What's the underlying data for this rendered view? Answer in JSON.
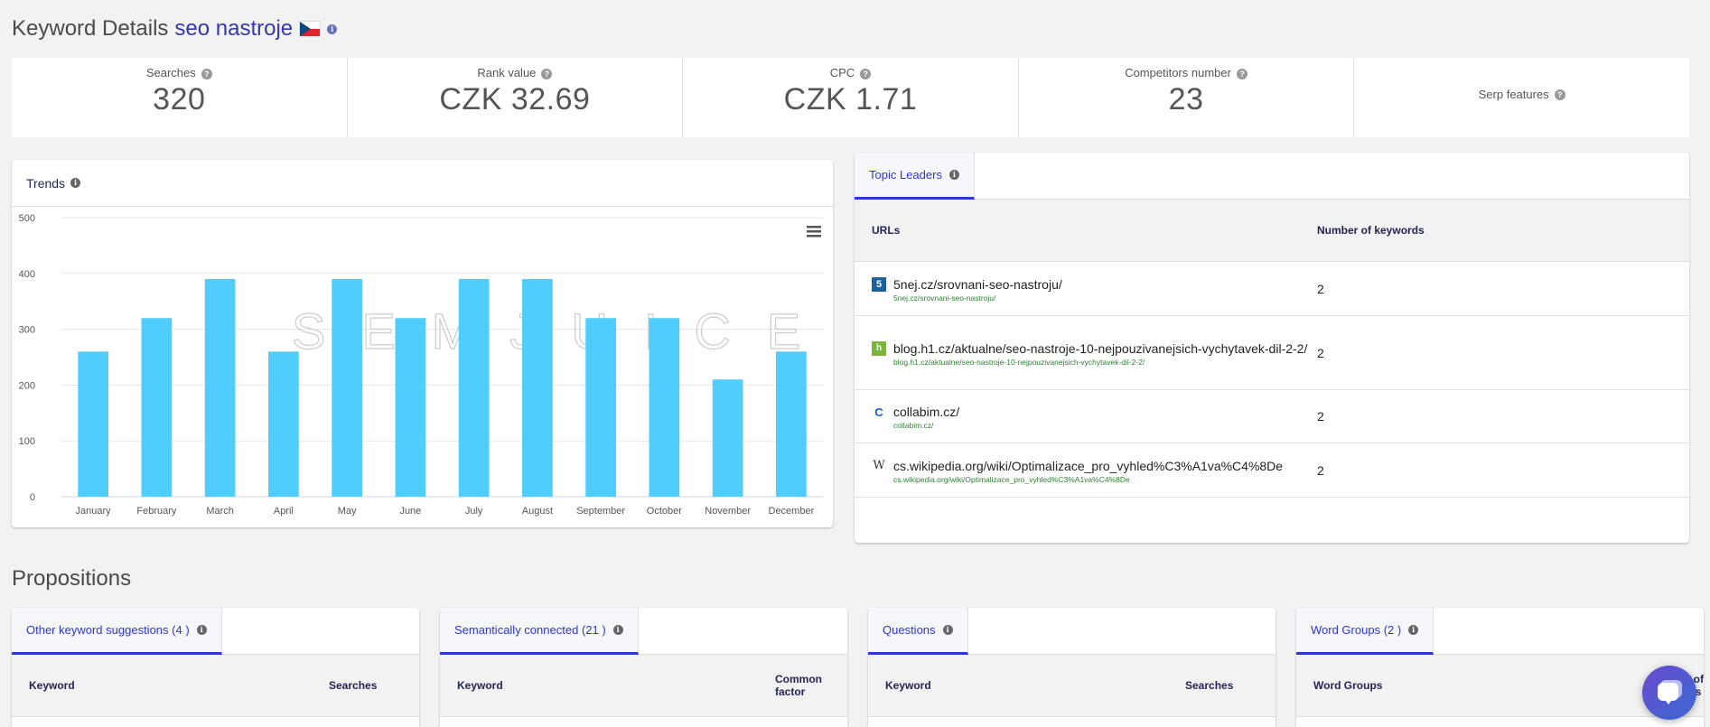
{
  "header": {
    "title": "Keyword Details",
    "keyword": "seo nastroje",
    "country_flag": "czech-republic-flag",
    "info_icon": "info-icon"
  },
  "stats": [
    {
      "label": "Searches",
      "value": "320"
    },
    {
      "label": "Rank value",
      "value": "CZK 32.69"
    },
    {
      "label": "CPC",
      "value": "CZK 1.71"
    },
    {
      "label": "Competitors number",
      "value": "23"
    },
    {
      "label": "Serp features",
      "value": ""
    }
  ],
  "trends": {
    "title": "Trends",
    "menu_icon": "hamburger-menu-icon",
    "watermark": "SEMJUICE"
  },
  "chart_data": {
    "type": "bar",
    "title": "Trends",
    "categories": [
      "January",
      "February",
      "March",
      "April",
      "May",
      "June",
      "July",
      "August",
      "September",
      "October",
      "November",
      "December"
    ],
    "values": [
      260,
      320,
      390,
      260,
      390,
      320,
      390,
      390,
      320,
      320,
      210,
      260
    ],
    "yticks": [
      "0",
      "100",
      "200",
      "300",
      "400",
      "500"
    ],
    "ylim": [
      0,
      500
    ],
    "xlabel": "",
    "ylabel": "",
    "grid": true,
    "bar_color": "#4fcdfd"
  },
  "topic_leaders": {
    "tab_label": "Topic Leaders",
    "columns": [
      "URLs",
      "Number of keywords"
    ],
    "rows": [
      {
        "icon": "5nej-favicon",
        "url": "5nej.cz/srovnani-seo-nastroju/",
        "sub": "5nej.cz/srovnani-seo-nastroju/",
        "count": "2"
      },
      {
        "icon": "h1-favicon",
        "url": "blog.h1.cz/aktualne/seo-nastroje-10-nejpouzivanejsich-vychytavek-dil-2-2/",
        "sub": "blog.h1.cz/aktualne/seo-nastroje-10-nejpouzivanejsich-vychytavek-dil-2-2/",
        "count": "2"
      },
      {
        "icon": "collabim-favicon",
        "url": "collabim.cz/",
        "sub": "collabim.cz/",
        "count": "2"
      },
      {
        "icon": "wikipedia-favicon",
        "url": "cs.wikipedia.org/wiki/Optimalizace_pro_vyhled%C3%A1va%C4%8De",
        "sub": "cs.wikipedia.org/wiki/Optimalizace_pro_vyhled%C3%A1va%C4%8De",
        "count": "2"
      }
    ]
  },
  "propositions": {
    "title": "Propositions",
    "cards": [
      {
        "tab": "Other keyword suggestions",
        "count": "(4 )",
        "col1": "Keyword",
        "col2": "Searches"
      },
      {
        "tab": "Semantically connected",
        "count": "(21 )",
        "col1": "Keyword",
        "col2": "Common factor"
      },
      {
        "tab": "Questions",
        "count": "",
        "col1": "Keyword",
        "col2": "Searches"
      },
      {
        "tab": "Word Groups",
        "count": "(2 )",
        "col1": "Word Groups",
        "col2": "Number of Keywords"
      }
    ]
  },
  "chat_widget": {
    "icon": "chat-bubble-icon"
  },
  "colors": {
    "accent": "#2d36d0",
    "keyword": "#3339a8",
    "bar": "#4fcdfd",
    "url_sub": "#2e7d32"
  }
}
